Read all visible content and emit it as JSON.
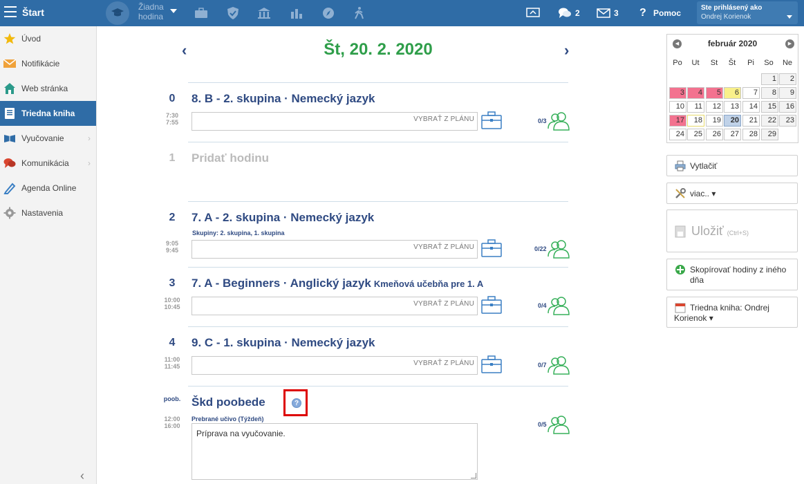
{
  "topbar": {
    "start": "Štart",
    "lesson_line1": "Žiadna",
    "lesson_line2": "hodina",
    "messages_count": "2",
    "mail_count": "3",
    "help": "Pomoc",
    "logged_in_as": "Ste prihlásený ako",
    "user_name": "Ondrej Korienok"
  },
  "sidebar": {
    "items": [
      {
        "label": "Úvod",
        "icon": "star-icon"
      },
      {
        "label": "Notifikácie",
        "icon": "envelope-icon"
      },
      {
        "label": "Web stránka",
        "icon": "house-icon"
      },
      {
        "label": "Triedna kniha",
        "icon": "book-icon"
      },
      {
        "label": "Vyučovanie",
        "icon": "open-book-icon"
      },
      {
        "label": "Komunikácia",
        "icon": "chat-icon"
      },
      {
        "label": "Agenda Online",
        "icon": "pencil-icon"
      },
      {
        "label": "Nastavenia",
        "icon": "gear-icon"
      }
    ]
  },
  "main": {
    "date": "Št, 20. 2. 2020",
    "plan_placeholder": "VYBRAŤ Z PLÁNU",
    "lessons": [
      {
        "num": "0",
        "title": "8. B - 2. skupina · Nemecký jazyk",
        "time1": "7:30",
        "time2": "7:55",
        "count": "0/3"
      },
      {
        "num": "1",
        "title": "Pridať hodinu"
      },
      {
        "num": "2",
        "title": "7. A - 2. skupina · Nemecký jazyk",
        "groups": "Skupiny:  2. skupina, 1. skupina",
        "time1": "9:05",
        "time2": "9:45",
        "count": "0/22"
      },
      {
        "num": "3",
        "title": "7. A - Beginners · Anglický jazyk",
        "room": "Kmeňová učebňa pre 1. A",
        "time1": "10:00",
        "time2": "10:45",
        "count": "0/4"
      },
      {
        "num": "4",
        "title": "9. C - 1. skupina · Nemecký jazyk",
        "time1": "11:00",
        "time2": "11:45",
        "count": "0/7"
      },
      {
        "num": "poob.",
        "title": "Škd poobede",
        "time1": "12:00",
        "time2": "16:00",
        "count": "0/5",
        "topic_label": "Prebrané učivo (Týždeň)",
        "topic_text": "Príprava na vyučovanie."
      }
    ]
  },
  "calendar": {
    "month": "február 2020",
    "days": [
      "Po",
      "Ut",
      "St",
      "Št",
      "Pi",
      "So",
      "Ne"
    ],
    "rows": [
      [
        "",
        "",
        "",
        "",
        "",
        "1",
        "2"
      ],
      [
        "3",
        "4",
        "5",
        "6",
        "7",
        "8",
        "9"
      ],
      [
        "10",
        "11",
        "12",
        "13",
        "14",
        "15",
        "16"
      ],
      [
        "17",
        "18",
        "19",
        "20",
        "21",
        "22",
        "23"
      ],
      [
        "24",
        "25",
        "26",
        "27",
        "28",
        "29",
        ""
      ]
    ]
  },
  "actions": {
    "print": "Vytlačiť",
    "more": "viac.. ▾",
    "save": "Uložiť",
    "save_hint": "(Ctrl+S)",
    "copy": "Skopírovať hodiny z iného dňa",
    "class_book": "Triedna kniha: Ondrej Korienok ▾"
  }
}
